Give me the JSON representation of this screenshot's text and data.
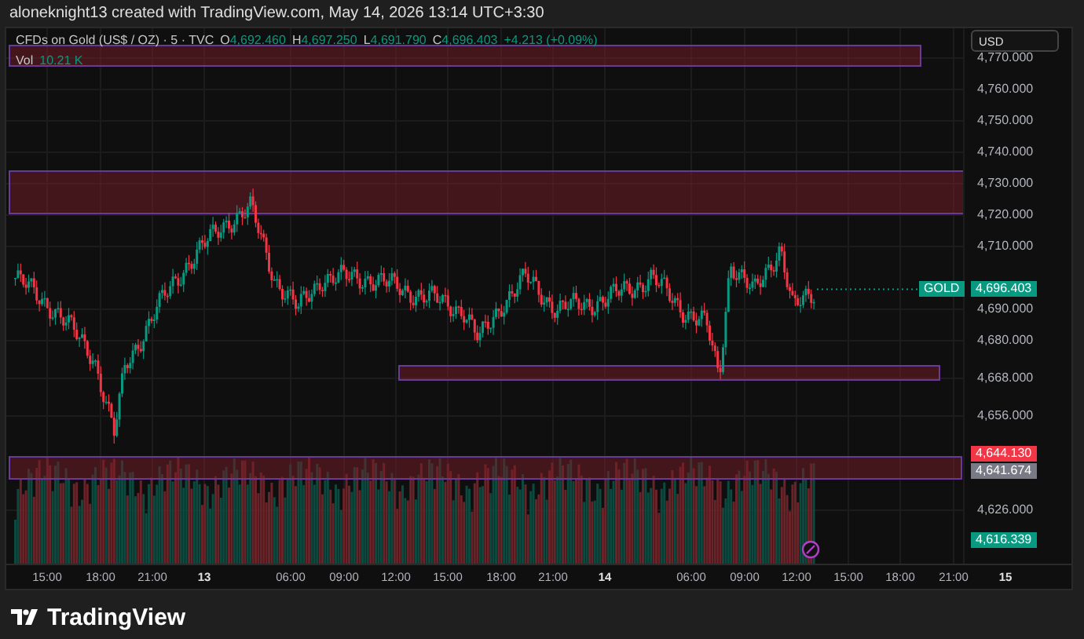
{
  "header": {
    "caption": "aloneknight13 created with TradingView.com, May 14, 2026 13:14 UTC+3:30"
  },
  "legend": {
    "symbol": "CFDs on Gold (US$ / OZ) · 5 · TVC",
    "ohlc": [
      {
        "label": "O",
        "value": "4,692.460"
      },
      {
        "label": "H",
        "value": "4,697.250"
      },
      {
        "label": "L",
        "value": "4,691.790"
      },
      {
        "label": "C",
        "value": "4,696.403"
      }
    ],
    "change": "+4.213 (+0.09%)"
  },
  "volume": {
    "label": "Vol",
    "value": "10.21 K"
  },
  "price_axis": {
    "currency": "USD",
    "ticks": [
      "4,770.000",
      "4,760.000",
      "4,750.000",
      "4,740.000",
      "4,730.000",
      "4,720.000",
      "4,710.000",
      "4,690.000",
      "4,680.000",
      "4,668.000",
      "4,656.000",
      "4,626.000"
    ]
  },
  "badges": [
    {
      "label": "GOLD",
      "value": "4,696.403",
      "color": "#089981"
    },
    {
      "value": "4,644.130",
      "color": "#f23645"
    },
    {
      "value": "4,641.674",
      "color": "#787b86"
    },
    {
      "value": "4,616.339",
      "color": "#089981"
    }
  ],
  "time_axis": [
    {
      "text": "15:00",
      "day": false
    },
    {
      "text": "18:00",
      "day": false
    },
    {
      "text": "21:00",
      "day": false
    },
    {
      "text": "13",
      "day": true
    },
    {
      "text": "06:00",
      "day": false
    },
    {
      "text": "09:00",
      "day": false
    },
    {
      "text": "12:00",
      "day": false
    },
    {
      "text": "15:00",
      "day": false
    },
    {
      "text": "18:00",
      "day": false
    },
    {
      "text": "21:00",
      "day": false
    },
    {
      "text": "14",
      "day": true
    },
    {
      "text": "06:00",
      "day": false
    },
    {
      "text": "09:00",
      "day": false
    },
    {
      "text": "12:00",
      "day": false
    },
    {
      "text": "15:00",
      "day": false
    },
    {
      "text": "18:00",
      "day": false
    },
    {
      "text": "21:00",
      "day": false
    },
    {
      "text": "15",
      "day": true
    }
  ],
  "footer": {
    "logo_text": "TradingView"
  }
}
